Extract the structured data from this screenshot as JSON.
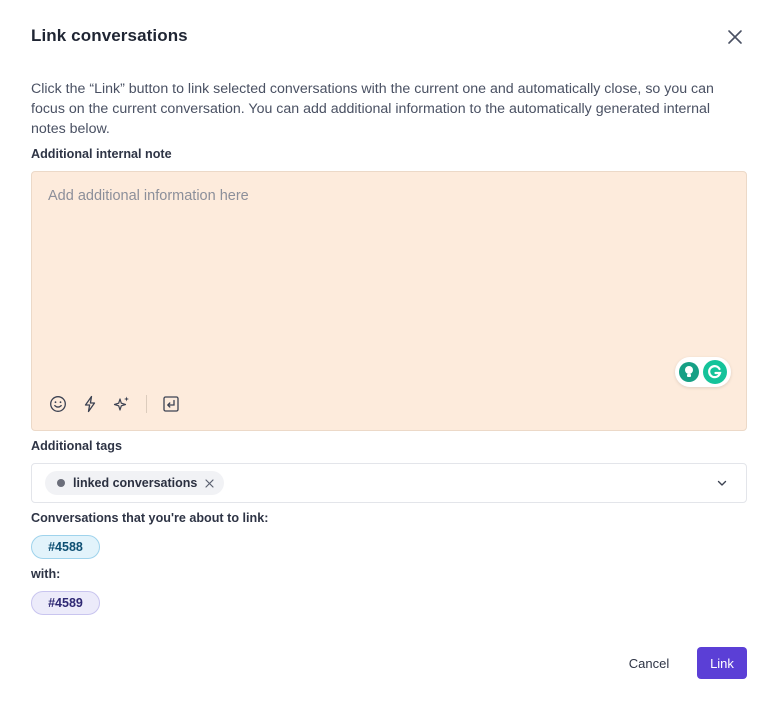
{
  "dialog": {
    "title": "Link conversations",
    "description": "Click the “Link” button to link selected conversations with the current one and automatically close, so you can focus on the current conversation. You can add additional information to the automatically generated internal notes below."
  },
  "note": {
    "label": "Additional internal note",
    "placeholder": "Add additional information here",
    "background_color": "#fdebdc",
    "toolbar_icons": [
      "emoji-icon",
      "lightning-icon",
      "sparkles-icon",
      "shortcut-icon"
    ]
  },
  "tags": {
    "label": "Additional tags",
    "selected": [
      {
        "label": "linked conversations"
      }
    ]
  },
  "conversations": {
    "label": "Conversations that you're about to link:",
    "source": "#4588",
    "with_label": "with:",
    "target": "#4589"
  },
  "footer": {
    "cancel_label": "Cancel",
    "link_label": "Link",
    "link_color": "#5b3fd6"
  }
}
